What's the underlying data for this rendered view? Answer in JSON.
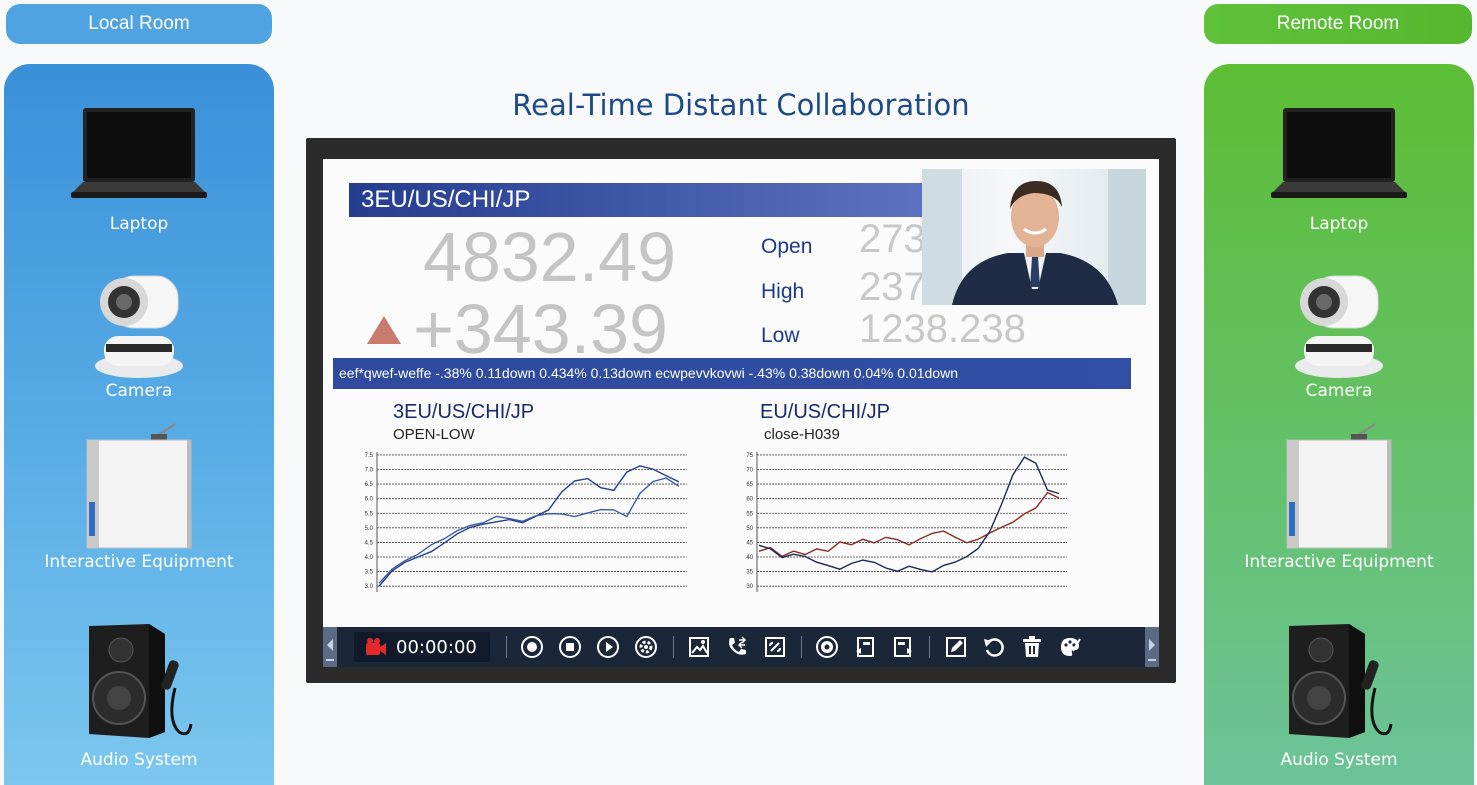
{
  "rooms": {
    "local": {
      "label": "Local Room",
      "devices": [
        "Laptop",
        "Camera",
        "Interactive Equipment",
        "Audio System"
      ],
      "color": "#3a90d8"
    },
    "remote": {
      "label": "Remote Room",
      "devices": [
        "Laptop",
        "Camera",
        "Interactive Equipment",
        "Audio System"
      ],
      "color": "#5cbe34"
    }
  },
  "title": "Real-Time Distant Collaboration",
  "screen": {
    "ticker_title": "3EU/US/CHI/JP",
    "price": "4832.49",
    "change": "+343.39",
    "stats": [
      {
        "label": "Open",
        "value": "273"
      },
      {
        "label": "High",
        "value": "237"
      },
      {
        "label": "Low",
        "value": "1238.238"
      }
    ],
    "marquee": "eef*qwef-weffe -.38%   0.11down   0.434%  0.13down  ecwpevvkovwi -.43%   0.38down   0.04%  0.01down",
    "chart_left": {
      "title": "3EU/US/CHI/JP",
      "subtitle": "OPEN-LOW"
    },
    "chart_right": {
      "title": "EU/US/CHI/JP",
      "subtitle": "close-H039"
    }
  },
  "toolbar": {
    "timer": "00:00:00",
    "icons": [
      "record-icon",
      "stop-icon",
      "play-icon",
      "settings-icon",
      "image-icon",
      "call-transfer-icon",
      "unlink-icon",
      "camera-shutter-icon",
      "ppt-prev-icon",
      "ppt-next-icon",
      "pen-icon",
      "undo-icon",
      "trash-icon",
      "palette-icon"
    ]
  },
  "chart_data": [
    {
      "type": "line",
      "title": "3EU/US/CHI/JP",
      "subtitle": "OPEN-LOW",
      "yticks": [
        "3.0",
        "3.5",
        "4.0",
        "4.5",
        "5.0",
        "5.5",
        "6.0",
        "6.5",
        "7.0",
        "7.5"
      ],
      "ylim": [
        2.8,
        7.6
      ],
      "series": [
        {
          "color": "#25408a",
          "values": [
            3.0,
            3.5,
            3.8,
            4.0,
            4.2,
            4.5,
            4.8,
            5.0,
            5.1,
            5.2,
            5.3,
            5.2,
            5.4,
            5.6,
            6.2,
            6.6,
            6.7,
            6.4,
            6.3,
            6.9,
            7.1,
            7.0,
            6.8,
            6.6
          ]
        },
        {
          "color": "#3a5ca8",
          "values": [
            3.1,
            3.6,
            3.9,
            4.1,
            4.4,
            4.6,
            4.9,
            5.1,
            5.2,
            5.4,
            5.3,
            5.2,
            5.4,
            5.5,
            5.5,
            5.4,
            5.5,
            5.6,
            5.6,
            5.4,
            6.2,
            6.6,
            6.7,
            6.4
          ]
        }
      ]
    },
    {
      "type": "line",
      "title": "EU/US/CHI/JP",
      "subtitle": "close-H039",
      "yticks": [
        "30",
        "35",
        "40",
        "45",
        "50",
        "55",
        "60",
        "65",
        "70",
        "75"
      ],
      "ylim": [
        28,
        76
      ],
      "series": [
        {
          "color": "#8b2b25",
          "values": [
            42,
            43,
            40,
            42,
            41,
            43,
            42,
            45,
            44,
            46,
            45,
            47,
            46,
            44,
            46,
            48,
            49,
            47,
            45,
            46,
            48,
            50,
            52,
            55,
            57,
            62,
            60
          ]
        },
        {
          "color": "#1b2a55",
          "values": [
            44,
            43,
            40,
            41,
            40,
            38,
            37,
            36,
            38,
            39,
            38,
            36,
            35,
            37,
            36,
            35,
            37,
            38,
            40,
            43,
            49,
            58,
            68,
            74,
            72,
            63,
            62
          ]
        }
      ]
    }
  ]
}
